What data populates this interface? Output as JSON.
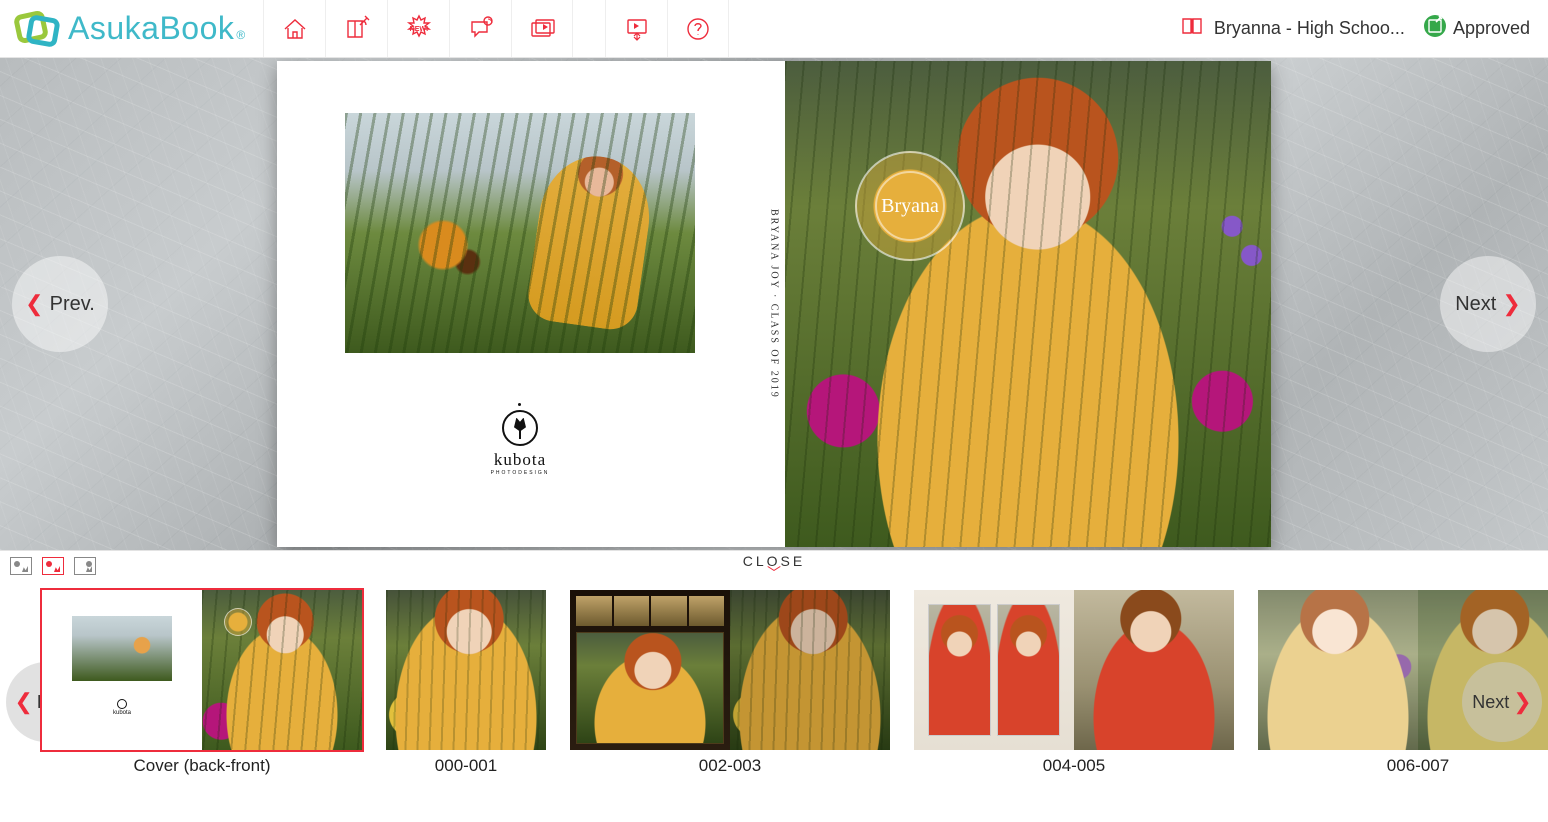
{
  "brand": {
    "name": "AsukaBook",
    "suffix": "®"
  },
  "toolbar": {
    "home": "Home",
    "edit": "Edit",
    "new": "NEW!",
    "comments": "Comments",
    "slideshow": "Slideshow",
    "export": "Export",
    "help": "Help"
  },
  "project": {
    "book_name": "Bryanna - High Schoo...",
    "status_label": "Approved"
  },
  "viewer": {
    "prev_label": "Prev.",
    "next_label": "Next"
  },
  "spread": {
    "spine_text": "BRYANA JOY  ·  CLASS OF 2019",
    "seal_text": "Bryana",
    "back_logo_text": "kubota",
    "back_logo_sub": "PHOTODESIGN"
  },
  "tray": {
    "close_label": "CLOSE",
    "prev_label": "Prev.",
    "next_label": "Next",
    "view_modes": {
      "single": "single",
      "active": "spread",
      "grid": "grid"
    }
  },
  "thumbnails": [
    {
      "id": "cover",
      "label": "Cover (back-front)",
      "selected": true,
      "type": "split"
    },
    {
      "id": "p000",
      "label": "000-001",
      "selected": false,
      "type": "narrow"
    },
    {
      "id": "p002",
      "label": "002-003",
      "selected": false,
      "type": "split"
    },
    {
      "id": "p004",
      "label": "004-005",
      "selected": false,
      "type": "split"
    },
    {
      "id": "p006",
      "label": "006-007",
      "selected": false,
      "type": "split"
    }
  ]
}
